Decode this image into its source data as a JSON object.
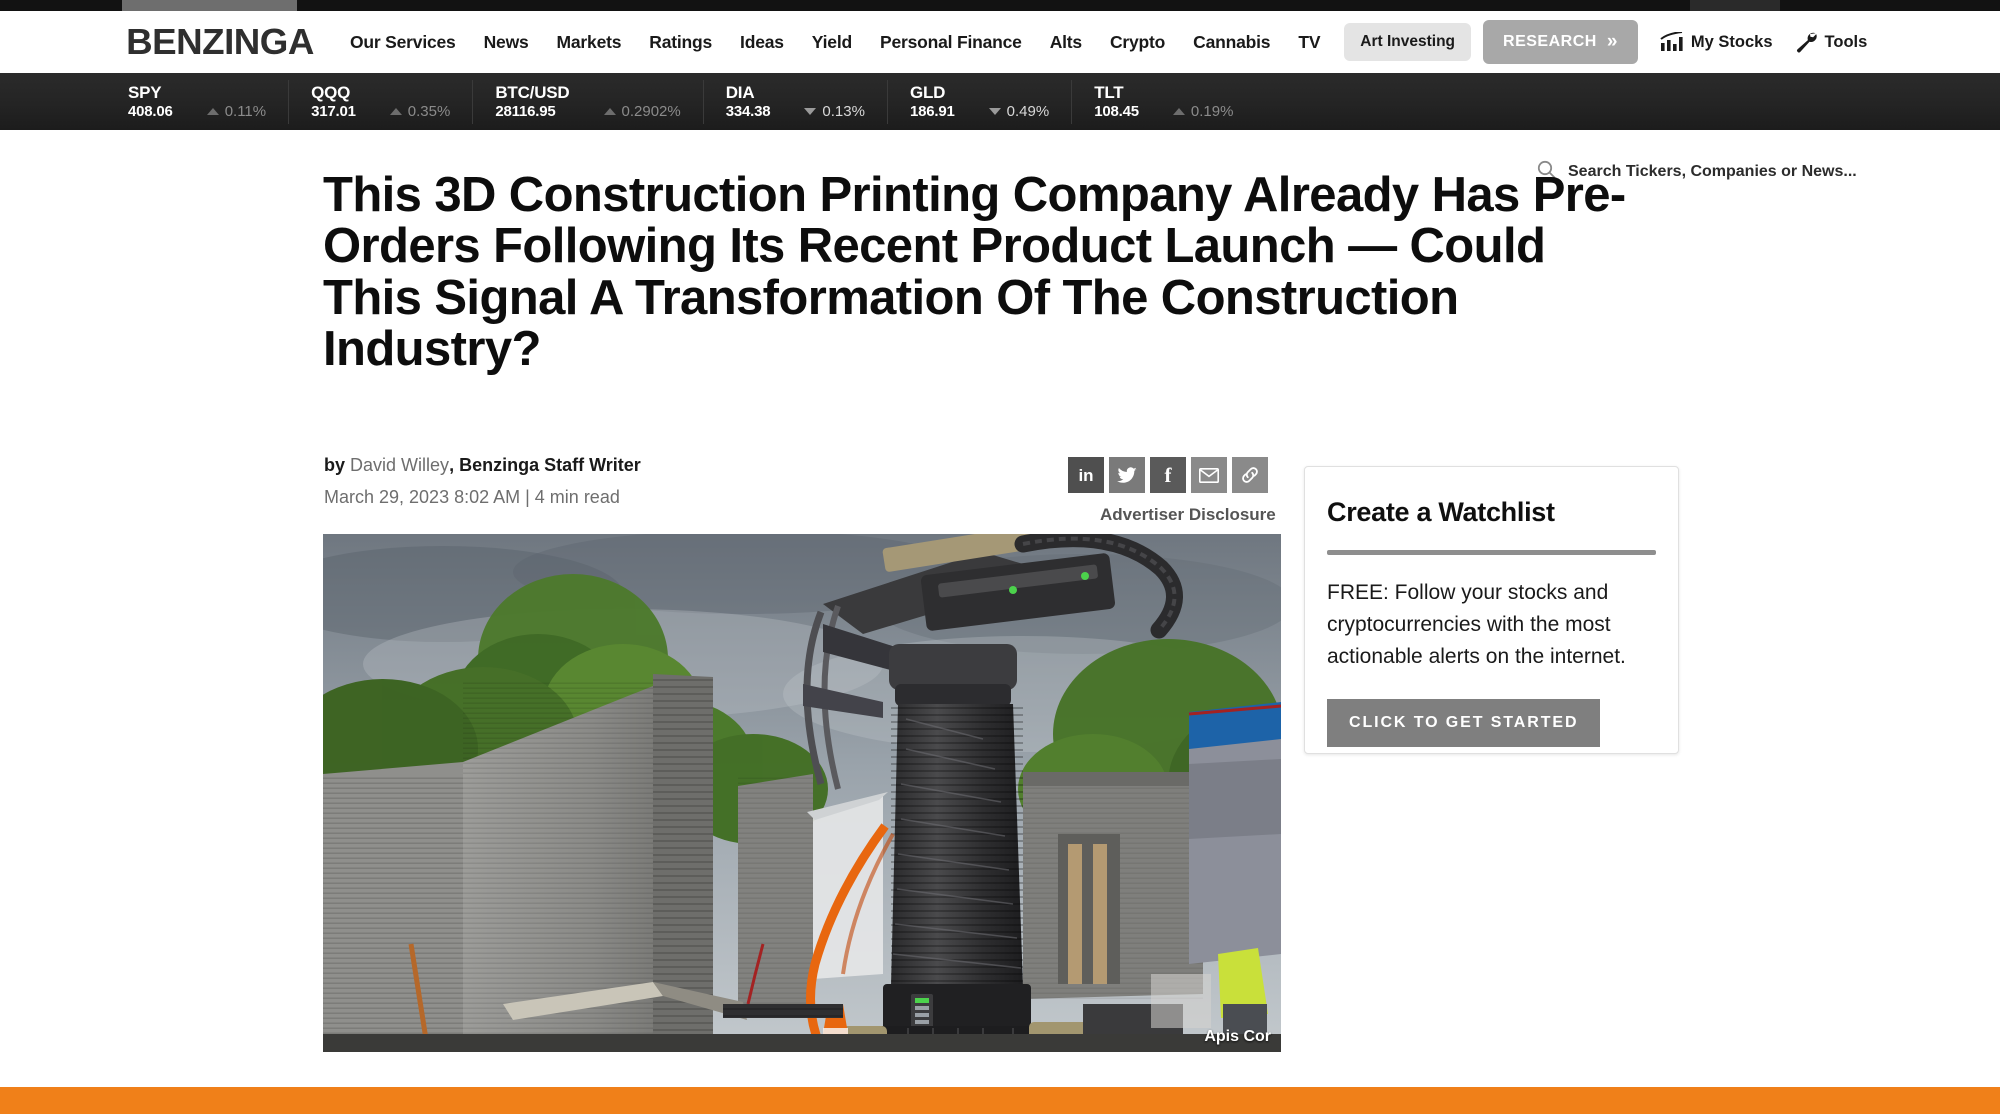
{
  "browser": {
    "tab_strip_present": true
  },
  "nav": {
    "logo": "BENZINGA",
    "links": [
      {
        "label": "Our Services"
      },
      {
        "label": "News"
      },
      {
        "label": "Markets"
      },
      {
        "label": "Ratings"
      },
      {
        "label": "Ideas"
      },
      {
        "label": "Yield"
      },
      {
        "label": "Personal Finance"
      },
      {
        "label": "Alts"
      },
      {
        "label": "Crypto"
      },
      {
        "label": "Cannabis"
      },
      {
        "label": "TV"
      }
    ],
    "art_investing_label": "Art Investing",
    "research_label": "RESEARCH",
    "research_chevrons": "»",
    "my_stocks_label": "My Stocks",
    "my_stocks_icon": "chart-icon",
    "tools_label": "Tools",
    "tools_icon": "wrench-icon"
  },
  "ticker": {
    "items": [
      {
        "symbol": "SPY",
        "price": "408.06",
        "change": "0.11%",
        "direction": "up",
        "dim": true
      },
      {
        "symbol": "QQQ",
        "price": "317.01",
        "change": "0.35%",
        "direction": "up",
        "dim": true
      },
      {
        "symbol": "BTC/USD",
        "price": "28116.95",
        "change": "0.2902%",
        "direction": "up",
        "dim": true
      },
      {
        "symbol": "DIA",
        "price": "334.38",
        "change": "0.13%",
        "direction": "down",
        "dim": false
      },
      {
        "symbol": "GLD",
        "price": "186.91",
        "change": "0.49%",
        "direction": "down",
        "dim": false
      },
      {
        "symbol": "TLT",
        "price": "108.45",
        "change": "0.19%",
        "direction": "up",
        "dim": true
      }
    ]
  },
  "search": {
    "placeholder": "Search Tickers, Companies or News...",
    "value": "",
    "icon": "search-icon"
  },
  "article": {
    "headline": "This 3D Construction Printing Company Already Has Pre-Orders Following Its Recent Product Launch — Could This Signal A Transformation Of The Construction Industry?",
    "by_prefix": "by",
    "author": "David Willey",
    "author_suffix": ", ",
    "author_role": "Benzinga Staff Writer",
    "dateline": "March 29, 2023 8:02 AM | 4 min read",
    "advertiser_disclosure": "Advertiser Disclosure",
    "image_credit": "Apis Cor",
    "share": [
      {
        "name": "linkedin-share-button",
        "glyph": "in"
      },
      {
        "name": "twitter-share-button",
        "glyph": "twitter"
      },
      {
        "name": "facebook-share-button",
        "glyph": "f"
      },
      {
        "name": "email-share-button",
        "glyph": "envelope"
      },
      {
        "name": "copy-link-button",
        "glyph": "link"
      }
    ]
  },
  "watchlist": {
    "title": "Create a Watchlist",
    "body": "FREE: Follow your stocks and cryptocurrencies with the most actionable alerts on the internet.",
    "cta": "CLICK TO GET STARTED"
  },
  "colors": {
    "orange_bar": "#f08019",
    "research_pill": "#a8a8a8",
    "art_pill": "#e4e4e4",
    "ticker_bg": "#242424",
    "cta_button": "#7f7f7f"
  }
}
